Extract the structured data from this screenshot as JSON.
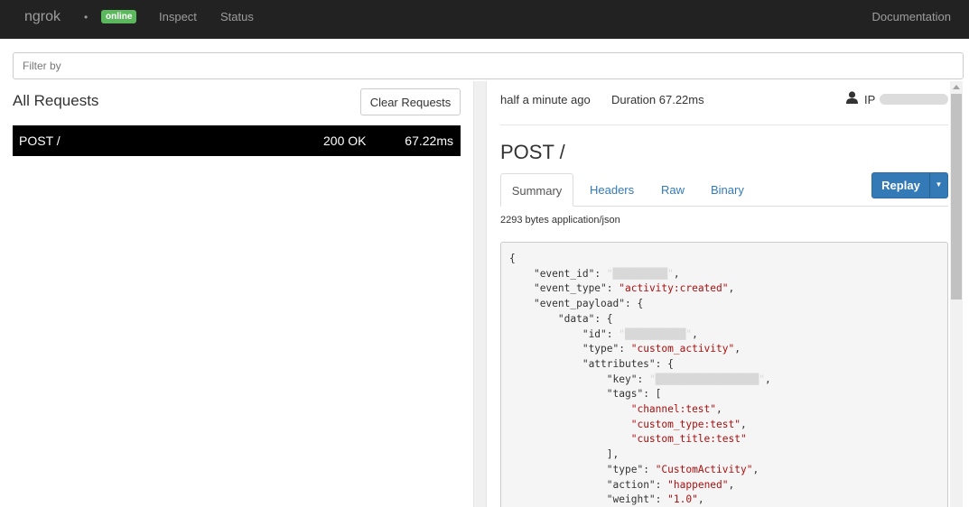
{
  "navbar": {
    "brand": "ngrok",
    "dot": "•",
    "status_badge": "online",
    "links": [
      "Inspect",
      "Status"
    ],
    "documentation": "Documentation"
  },
  "filter": {
    "placeholder": "Filter by"
  },
  "requests_panel": {
    "title": "All Requests",
    "clear_button": "Clear Requests",
    "rows": [
      {
        "method_path": "POST /",
        "status": "200 OK",
        "duration": "67.22ms"
      }
    ]
  },
  "detail": {
    "time_ago": "half a minute ago",
    "duration": "Duration  67.22ms",
    "ip_label": "IP",
    "title": "POST /",
    "tabs": [
      "Summary",
      "Headers",
      "Raw",
      "Binary"
    ],
    "active_tab": "Summary",
    "replay_label": "Replay",
    "size_info": "2293 bytes application/json",
    "body_lines": [
      {
        "indent": 0,
        "text": "{"
      },
      {
        "indent": 1,
        "key": "\"event_id\"",
        "value": "\"█████████\"",
        "redacted": true,
        "tail": ","
      },
      {
        "indent": 1,
        "key": "\"event_type\"",
        "value": "\"activity:created\"",
        "tail": ","
      },
      {
        "indent": 1,
        "key": "\"event_payload\"",
        "after": ": {"
      },
      {
        "indent": 2,
        "key": "\"data\"",
        "after": ": {"
      },
      {
        "indent": 3,
        "key": "\"id\"",
        "value": "\"██████████\"",
        "redacted": true,
        "tail": ","
      },
      {
        "indent": 3,
        "key": "\"type\"",
        "value": "\"custom_activity\"",
        "tail": ","
      },
      {
        "indent": 3,
        "key": "\"attributes\"",
        "after": ": {"
      },
      {
        "indent": 4,
        "key": "\"key\"",
        "value": "\"█████████████████\"",
        "redacted": true,
        "tail": ","
      },
      {
        "indent": 4,
        "key": "\"tags\"",
        "after": ": ["
      },
      {
        "indent": 5,
        "value": "\"channel:test\"",
        "tail": ","
      },
      {
        "indent": 5,
        "value": "\"custom_type:test\"",
        "tail": ","
      },
      {
        "indent": 5,
        "value": "\"custom_title:test\""
      },
      {
        "indent": 4,
        "text": "],"
      },
      {
        "indent": 4,
        "key": "\"type\"",
        "value": "\"CustomActivity\"",
        "tail": ","
      },
      {
        "indent": 4,
        "key": "\"action\"",
        "value": "\"happened\"",
        "tail": ","
      },
      {
        "indent": 4,
        "key": "\"weight\"",
        "value": "\"1.0\"",
        "tail": ","
      }
    ]
  },
  "colors": {
    "navbar_bg": "#222222",
    "online_badge": "#5cb85c",
    "replay_button": "#337ab7",
    "json_string": "#aa1111"
  },
  "icons": {
    "user": "user-icon",
    "caret": "caret-down-icon"
  }
}
